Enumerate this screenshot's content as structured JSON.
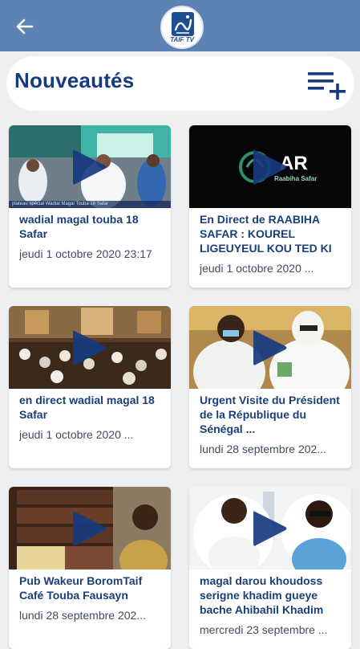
{
  "app": {
    "logo_text": "TAIF TV"
  },
  "header": {
    "title": "Nouveautés"
  },
  "colors": {
    "topbar": "#5d83b5",
    "title": "#173a7e",
    "card_title": "#1b3f77",
    "background": "#eeeff1",
    "play_button": "#173a7e"
  },
  "icons": {
    "back": "arrow-left-icon",
    "playlist_add": "playlist-add-icon",
    "play": "play-icon"
  },
  "videos": [
    {
      "title": "wadial magal touba 18 Safar",
      "date": "jeudi 1 octobre 2020 23:17",
      "caption": "plateau spécial Wadial Magal Touba 18 Safar"
    },
    {
      "title": "En Direct de RAABIHA SAFAR : KOUREL LIGEUYEUL KOU TED KI",
      "date": "jeudi 1 octobre 2020 ...",
      "logo_text": "Raabiha Safar",
      "logo_big": "AR"
    },
    {
      "title": "en direct  wadial magal 18 Safar",
      "date": "jeudi 1 octobre 2020 ..."
    },
    {
      "title": "Urgent  Visite du Président de la République du Sénégal ...",
      "date": "lundi 28 septembre 202..."
    },
    {
      "title": "Pub Wakeur BoromTaif Café Touba Fausayn",
      "date": "lundi 28 septembre 202..."
    },
    {
      "title": "magal darou khoudoss serigne khadim gueye bache Ahibahil Khadim",
      "date": "mercredi 23 septembre ..."
    }
  ]
}
